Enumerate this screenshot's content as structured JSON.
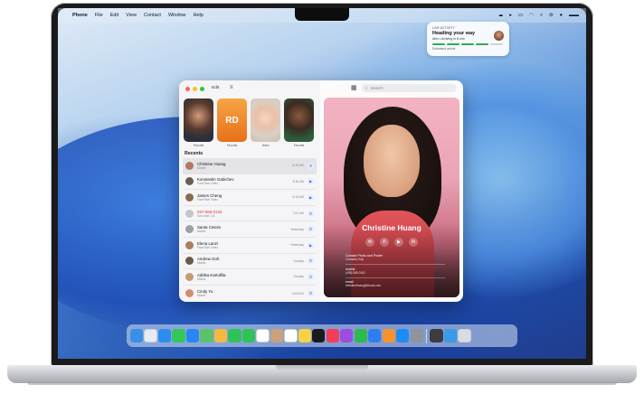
{
  "menubar": {
    "app": "Phone",
    "items": [
      "File",
      "Edit",
      "View",
      "Contact",
      "Window",
      "Help"
    ]
  },
  "notification": {
    "app": "Live Activity",
    "title": "Heading your way",
    "subtitle": "Alex • Arriving in 8 min",
    "eta": "Estimated arrival"
  },
  "window": {
    "edit_label": "Edit",
    "search_placeholder": "Search",
    "favorites": [
      {
        "initials": "",
        "label": "Favorite",
        "color": "#2b2f3a"
      },
      {
        "initials": "RD",
        "label": "Favorite",
        "color": "#f08a24"
      },
      {
        "initials": "",
        "label": "Video",
        "color": "#e6d8c9"
      },
      {
        "initials": "",
        "label": "Favorite",
        "color": "#2c5d3a"
      }
    ],
    "recents_title": "Recents",
    "recents": [
      {
        "name": "Christine Huang",
        "sub": "Mobile",
        "time": "8:49 AM",
        "icon": "phone",
        "red": false,
        "avatar": "#b07a5e"
      },
      {
        "name": "Konstantin Gabichev",
        "sub": "FaceTime Video",
        "time": "8:36 AM",
        "icon": "video",
        "red": false,
        "avatar": "#6b5d52"
      },
      {
        "name": "James Cheng",
        "sub": "FaceTime Video",
        "time": "8:16 AM",
        "icon": "video",
        "red": false,
        "avatar": "#8a6a4f"
      },
      {
        "name": "267-555-0132",
        "sub": "San Jose, CA",
        "time": "7:51 AM",
        "icon": "phone",
        "red": true,
        "avatar": "#c4c6cc"
      },
      {
        "name": "Santa Cetera",
        "sub": "Mobile",
        "time": "Yesterday",
        "icon": "phone",
        "red": false,
        "avatar": "#9aa0a8"
      },
      {
        "name": "Elena Lanzi",
        "sub": "FaceTime Video",
        "time": "Yesterday",
        "icon": "video",
        "red": false,
        "avatar": "#a97f5d"
      },
      {
        "name": "Andrew Goh",
        "sub": "Mobile",
        "time": "Sunday",
        "icon": "phone",
        "red": false,
        "avatar": "#6f5847"
      },
      {
        "name": "Aditika Kartufilla",
        "sub": "Mobile",
        "time": "Sunday",
        "icon": "phone",
        "red": false,
        "avatar": "#c89a74"
      },
      {
        "name": "Cindy Yu",
        "sub": "Mobile",
        "time": "10/04/24",
        "icon": "phone",
        "red": false,
        "avatar": "#d18e6c"
      }
    ]
  },
  "contact": {
    "name": "Christine Huang",
    "poster_label": "Contact Photo and Poster",
    "poster_sub": "Contacts Only",
    "mobile_label": "mobile",
    "mobile_value": "(408) 555-0162",
    "email_label": "email",
    "email_value": "christinehuang@icloud.com"
  },
  "dock": [
    {
      "name": "finder-icon",
      "color": "#3b8fe8"
    },
    {
      "name": "launchpad-icon",
      "color": "#e8ecf2"
    },
    {
      "name": "safari-icon",
      "color": "#2d8cf0"
    },
    {
      "name": "messages-icon",
      "color": "#34c759"
    },
    {
      "name": "mail-icon",
      "color": "#2a86f2"
    },
    {
      "name": "maps-icon",
      "color": "#5cc26a"
    },
    {
      "name": "photos-icon",
      "color": "#f5b942"
    },
    {
      "name": "facetime-icon",
      "color": "#2fc25b"
    },
    {
      "name": "phone-icon",
      "color": "#30c254"
    },
    {
      "name": "calendar-icon",
      "color": "#ffffff"
    },
    {
      "name": "contacts-icon",
      "color": "#c8a27a"
    },
    {
      "name": "reminders-icon",
      "color": "#ffffff"
    },
    {
      "name": "notes-icon",
      "color": "#f7d247"
    },
    {
      "name": "tv-icon",
      "color": "#1b1b1d"
    },
    {
      "name": "music-icon",
      "color": "#f43d5a"
    },
    {
      "name": "podcasts-icon",
      "color": "#9a4de0"
    },
    {
      "name": "numbers-icon",
      "color": "#2dbb4f"
    },
    {
      "name": "keynote-icon",
      "color": "#2d7ff0"
    },
    {
      "name": "pages-icon",
      "color": "#f7932b"
    },
    {
      "name": "app-store-icon",
      "color": "#1f8bf5"
    },
    {
      "name": "system-settings-icon",
      "color": "#8e949b"
    },
    {
      "name": "iphone-mirroring-icon",
      "color": "#3b3d42"
    },
    {
      "name": "downloads-icon",
      "color": "#3a9be8"
    },
    {
      "name": "trash-icon",
      "color": "#d8dde3"
    }
  ]
}
